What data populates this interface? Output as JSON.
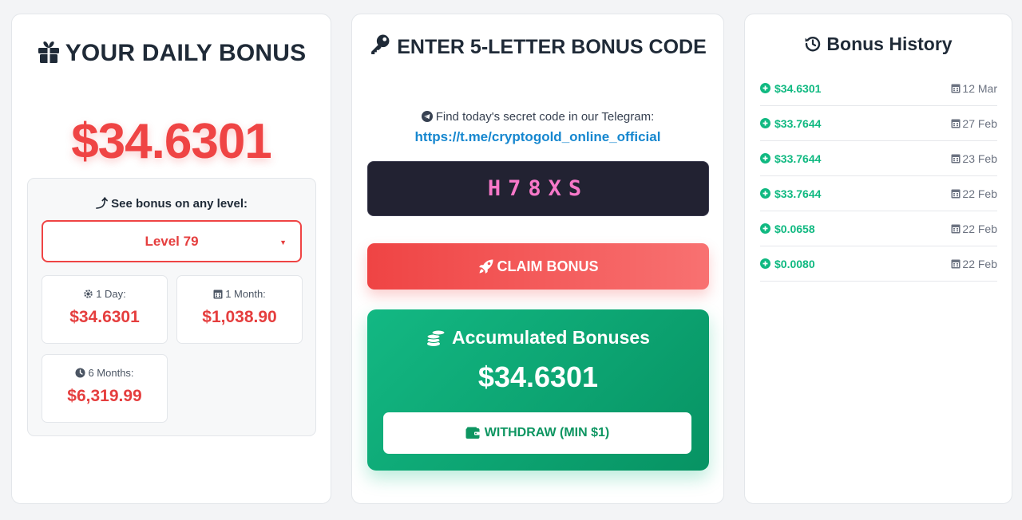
{
  "daily": {
    "title": "YOUR DAILY BONUS",
    "amount": "$34.6301",
    "level_prompt": "See bonus on any level:",
    "level_selected": "Level 79",
    "stats": [
      {
        "label": "1 Day:",
        "value": "$34.6301",
        "icon": "gear-icon"
      },
      {
        "label": "1 Month:",
        "value": "$1,038.90",
        "icon": "calendar-icon"
      },
      {
        "label": "6 Months:",
        "value": "$6,319.99",
        "icon": "clock-icon"
      }
    ]
  },
  "code": {
    "title": "ENTER 5-LETTER BONUS CODE",
    "hint": "Find today's secret code in our Telegram:",
    "link": "https://t.me/cryptogold_online_official",
    "input_value": "H78XS",
    "claim_label": "CLAIM BONUS",
    "accumulated_title": "Accumulated Bonuses",
    "accumulated_amount": "$34.6301",
    "withdraw_label": "WITHDRAW (MIN $1)"
  },
  "history": {
    "title": "Bonus History",
    "items": [
      {
        "amount": "$34.6301",
        "date": "12 Mar"
      },
      {
        "amount": "$33.7644",
        "date": "27 Feb"
      },
      {
        "amount": "$33.7644",
        "date": "23 Feb"
      },
      {
        "amount": "$33.7644",
        "date": "22 Feb"
      },
      {
        "amount": "$0.0658",
        "date": "22 Feb"
      },
      {
        "amount": "$0.0080",
        "date": "22 Feb"
      }
    ]
  },
  "colors": {
    "accent_red": "#ef4444",
    "accent_green": "#10b981",
    "code_text": "#f778c9",
    "link_blue": "#1687cf"
  }
}
